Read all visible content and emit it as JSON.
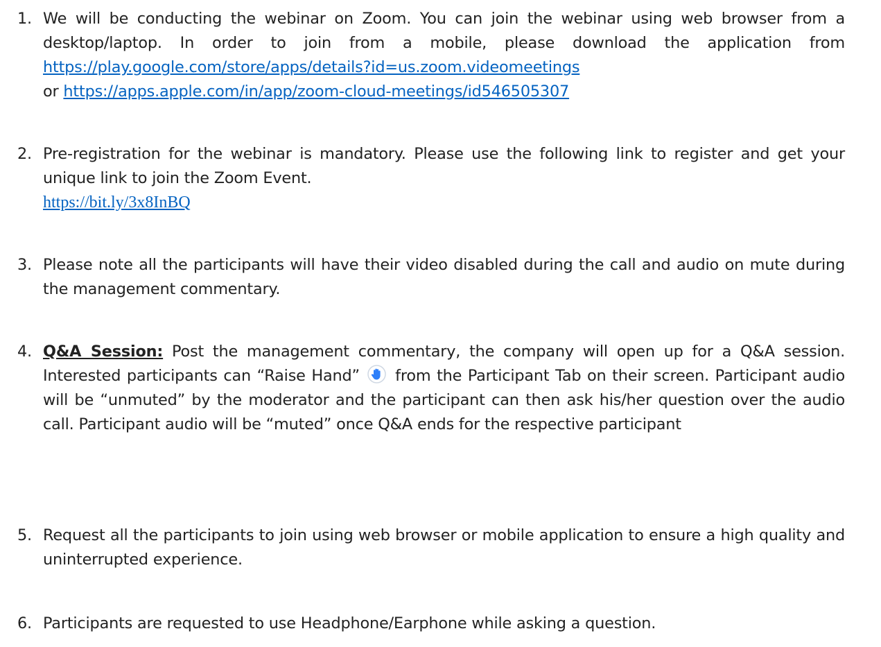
{
  "items": [
    {
      "num": "1.",
      "t1": "We will be conducting the webinar on Zoom. You can join the webinar using web browser from a desktop/laptop. In order to join from a mobile, please download the application from ",
      "link1": "https://play.google.com/store/apps/details?id=us.zoom.videomeetings",
      "t2": "or ",
      "link2": "https://apps.apple.com/in/app/zoom-cloud-meetings/id546505307"
    },
    {
      "num": "2.",
      "t1": "Pre-registration for the webinar is mandatory. Please use the following link to register and get your unique link to join the Zoom Event.",
      "link": "https://bit.ly/3x8InBQ"
    },
    {
      "num": "3.",
      "text": "Please note all the participants will have their video disabled during the call and audio on mute during the management commentary."
    },
    {
      "num": "4.",
      "bold": "Q&A Session:",
      "t1": " Post the management commentary, the company will open up for a Q&A session. Interested participants can “Raise Hand” ",
      "t2": " from the Participant Tab on their screen. Participant audio will be “unmuted” by the moderator and the participant can then ask his/her question over the audio call. Participant audio will be “muted” once Q&A ends for the respective participant",
      "icon": "raise-hand-icon"
    },
    {
      "num": "5.",
      "text": "Request all the participants to join using web browser or mobile application to ensure a high quality and uninterrupted experience."
    },
    {
      "num": "6.",
      "text": "Participants are requested to use Headphone/Earphone while asking a question."
    }
  ],
  "colors": {
    "text": "#222222",
    "link": "#0563c1",
    "icon": "#2d7ff9"
  }
}
